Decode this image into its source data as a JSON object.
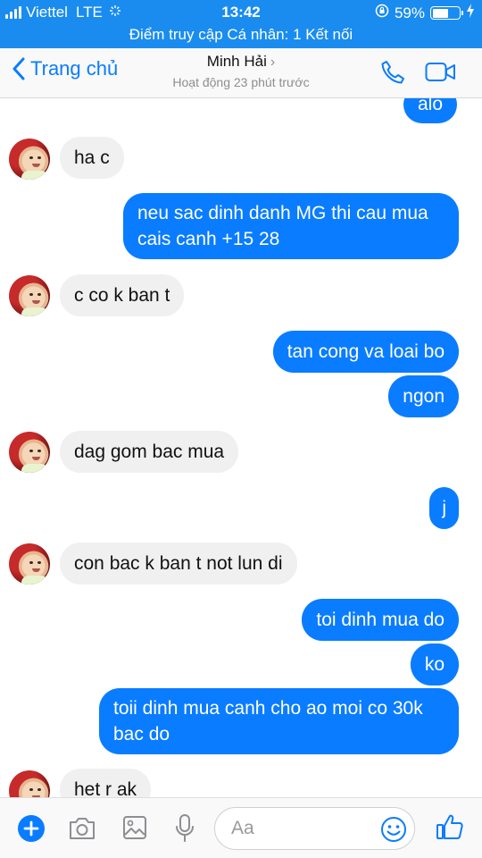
{
  "status_bar": {
    "carrier": "Viettel",
    "network": "LTE",
    "time": "13:42",
    "battery": "59%",
    "battery_level": 0.59
  },
  "hotspot_banner": "Điểm truy cập Cá nhân: 1 Kết nối",
  "header": {
    "back_label": "Trang chủ",
    "contact_name": "Minh Hải",
    "contact_status": "Hoạt động 23 phút trước"
  },
  "messages": [
    {
      "side": "out",
      "text": "alo"
    },
    {
      "side": "in",
      "text": "ha c"
    },
    {
      "side": "out",
      "text": "neu sac dinh danh MG thi cau mua cais canh +15  28"
    },
    {
      "side": "in",
      "text": "c co k ban t"
    },
    {
      "side": "out",
      "text": "tan cong va loai bo"
    },
    {
      "side": "out",
      "text": "ngon"
    },
    {
      "side": "in",
      "text": "dag gom bac mua"
    },
    {
      "side": "out",
      "text": "j"
    },
    {
      "side": "in",
      "text": "con bac k ban t not lun di"
    },
    {
      "side": "out",
      "text": "toi dinh mua do"
    },
    {
      "side": "out",
      "text": "ko"
    },
    {
      "side": "out",
      "text": "toii dinh mua canh cho ao moi co 30k bac do"
    },
    {
      "side": "in",
      "text": "het r ak"
    }
  ],
  "composer": {
    "placeholder": "Aa"
  },
  "colors": {
    "status_bar_bg": "#1a8cf0",
    "outgoing_bubble": "#0a7cff",
    "incoming_bubble": "#f0f0f0",
    "accent": "#0a7cff"
  },
  "icons": [
    "signal-icon",
    "settings-sync-icon",
    "rotation-lock-icon",
    "battery-icon",
    "charging-icon",
    "back-chevron-icon",
    "phone-icon",
    "video-camera-icon",
    "plus-icon",
    "camera-icon",
    "photo-icon",
    "microphone-icon",
    "emoji-icon",
    "thumbs-up-icon"
  ]
}
